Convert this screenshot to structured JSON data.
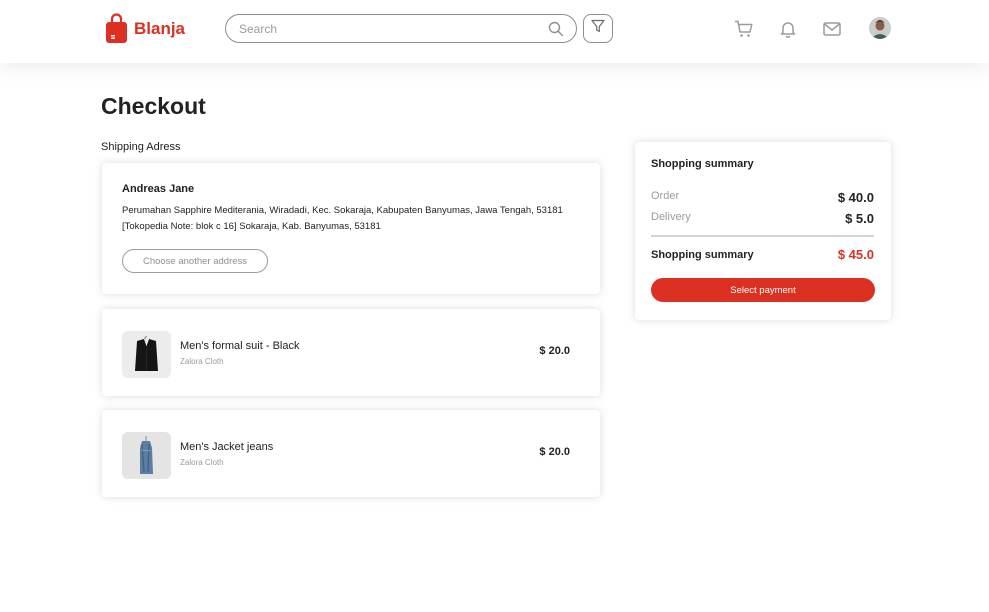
{
  "brand": {
    "name": "Blanja",
    "color": "#DB3022"
  },
  "header": {
    "search_placeholder": "Search",
    "icons": [
      "search-icon",
      "filter-icon",
      "cart-icon",
      "bell-icon",
      "mail-icon",
      "avatar"
    ]
  },
  "page": {
    "title": "Checkout"
  },
  "shipping": {
    "section_label": "Shipping Adress",
    "name": "Andreas Jane",
    "address": "Perumahan Sapphire Mediterania, Wiradadi, Kec. Sokaraja, Kabupaten Banyumas, Jawa Tengah, 53181 [Tokopedia Note: blok c 16] Sokaraja, Kab. Banyumas, 53181",
    "change_button": "Choose another address"
  },
  "items": [
    {
      "name": "Men's formal suit - Black",
      "store": "Zalora Cloth",
      "price": "$ 20.0",
      "image": "black-suit"
    },
    {
      "name": "Men's Jacket jeans",
      "store": "Zalora Cloth",
      "price": "$ 20.0",
      "image": "denim-jacket"
    }
  ],
  "summary": {
    "title": "Shopping summary",
    "order_label": "Order",
    "order_value": "$ 40.0",
    "delivery_label": "Delivery",
    "delivery_value": "$ 5.0",
    "total_label": "Shopping summary",
    "total_value": "$ 45.0",
    "pay_button": "Select payment"
  }
}
